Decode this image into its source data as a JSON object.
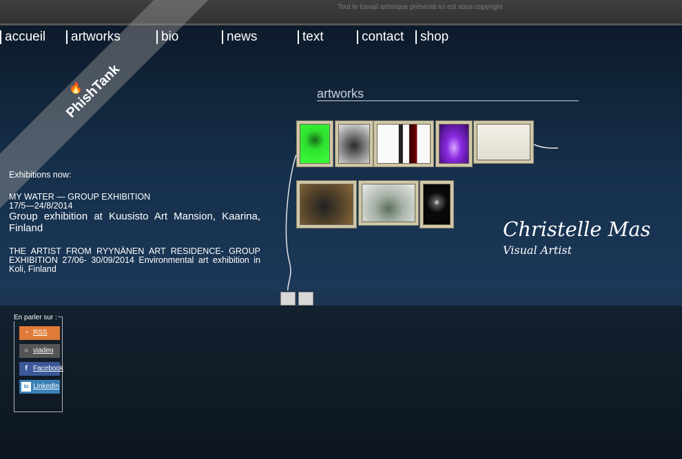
{
  "header": {
    "copyright": "Tout le travail artistique présenté ici est sous copyright"
  },
  "nav": {
    "items": [
      {
        "label": "accueil"
      },
      {
        "label": "artworks"
      },
      {
        "label": "bio"
      },
      {
        "label": "news"
      },
      {
        "label": "text"
      },
      {
        "label": "contact"
      },
      {
        "label": "shop"
      }
    ]
  },
  "logo": {
    "text": "PhishTank"
  },
  "section": {
    "title": "artworks"
  },
  "artworks": {
    "row1": [
      "green-figure",
      "metal-sculpture",
      "gallery-wall",
      "violet-pear",
      "exhibition-room"
    ],
    "row2": [
      "dark-stone",
      "circular-installation",
      "sparkle"
    ]
  },
  "exhibitions": {
    "heading": "Exhibitions now:",
    "item1_title": "MY WATER — GROUP EXHIBITION",
    "item1_dates": "17/5—24/8/2014",
    "item1_desc": "Group exhibition at Kuusisto Art Mansion, Kaarina, Finland",
    "item2_text": "THE ARTIST FROM RYYNÄNEN ART RESIDENCE-  GROUP EXHIBITION 27/06- 30/09/2014 Environmental art exhibition in Koli, Finland"
  },
  "artist": {
    "name": "Christelle Mas",
    "role": "Visual Artist"
  },
  "share": {
    "label": "En parler sur :",
    "buttons": [
      {
        "label": "RSS",
        "icon": "rss-icon",
        "color": "#e07b39"
      },
      {
        "label": "viadeo",
        "icon": "viadeo-icon",
        "color": "#555555"
      },
      {
        "label": "Facebook",
        "icon": "facebook-icon",
        "color": "#3b5998"
      },
      {
        "label": "LinkedIn",
        "icon": "linkedin-icon",
        "color": "#3a7fb5"
      }
    ]
  }
}
